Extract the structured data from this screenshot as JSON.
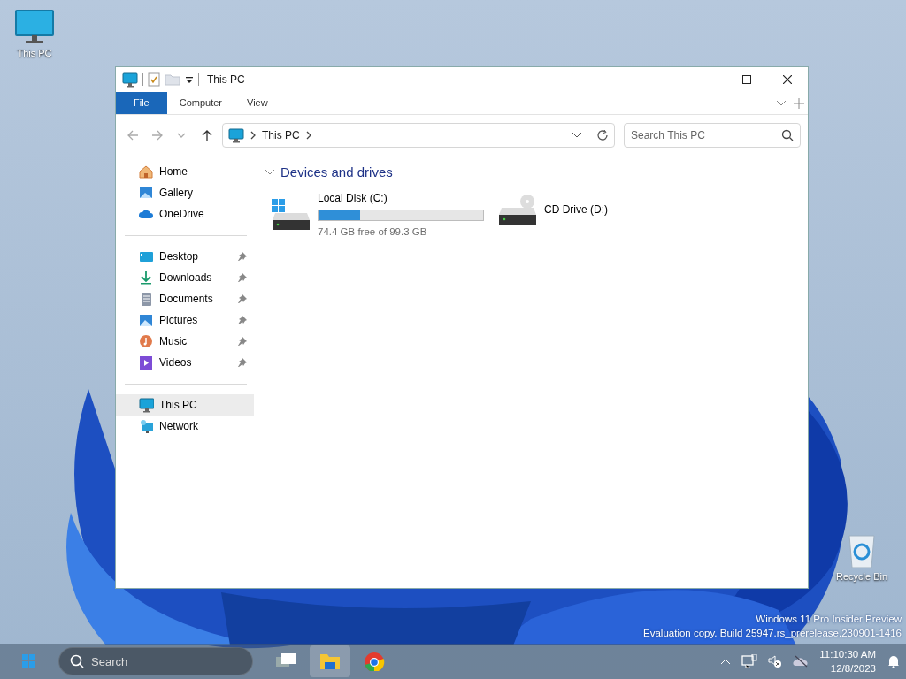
{
  "desktop_icons": [
    {
      "label": "This PC",
      "kind": "pc"
    },
    {
      "label": "Recycle Bin",
      "kind": "bin"
    }
  ],
  "window": {
    "title": "This PC",
    "ribbon_tabs": [
      {
        "label": "File",
        "selected": true
      },
      {
        "label": "Computer",
        "selected": false
      },
      {
        "label": "View",
        "selected": false
      }
    ],
    "address": {
      "path": [
        "This PC"
      ]
    },
    "search": {
      "placeholder": "Search This PC"
    },
    "sidebar": [
      [
        {
          "label": "Home",
          "pinned": false,
          "selected": false
        },
        {
          "label": "Gallery",
          "pinned": false,
          "selected": false
        },
        {
          "label": "OneDrive",
          "pinned": false,
          "selected": false
        }
      ],
      [
        {
          "label": "Desktop",
          "pinned": true,
          "selected": false
        },
        {
          "label": "Downloads",
          "pinned": true,
          "selected": false
        },
        {
          "label": "Documents",
          "pinned": true,
          "selected": false
        },
        {
          "label": "Pictures",
          "pinned": true,
          "selected": false
        },
        {
          "label": "Music",
          "pinned": true,
          "selected": false
        },
        {
          "label": "Videos",
          "pinned": true,
          "selected": false
        }
      ],
      [
        {
          "label": "This PC",
          "pinned": false,
          "selected": true
        },
        {
          "label": "Network",
          "pinned": false,
          "selected": false
        }
      ]
    ],
    "section": {
      "title": "Devices and drives",
      "expanded": true
    },
    "drives": [
      {
        "kind": "disk",
        "name": "Local Disk (C:)",
        "level": 0.25,
        "detail": "74.4 GB free of 99.3 GB"
      },
      {
        "kind": "cd",
        "name": "CD Drive (D:)"
      }
    ]
  },
  "desktop_notice": [
    "Windows 11 Pro Insider Preview",
    "Evaluation copy. Build 25947.rs_prerelease.230901-1416"
  ],
  "taskbar": {
    "search_placeholder": "Search",
    "apps": [
      {
        "kind": "taskview",
        "active": false
      },
      {
        "kind": "explorer",
        "active": true
      },
      {
        "kind": "chrome",
        "active": false
      }
    ],
    "time": "11:10:30 AM",
    "date": "12/8/2023"
  }
}
